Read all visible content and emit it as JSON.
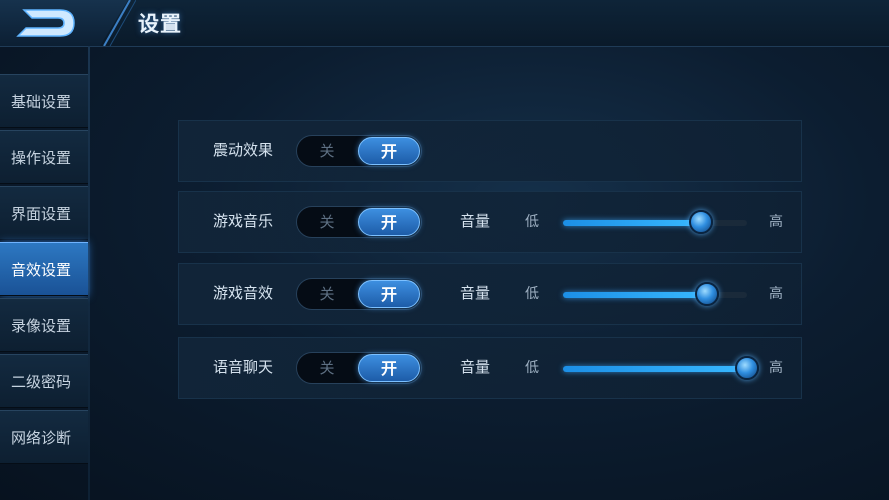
{
  "header": {
    "title": "设置"
  },
  "sidebar": {
    "items": [
      {
        "label": "基础设置",
        "active": false
      },
      {
        "label": "操作设置",
        "active": false
      },
      {
        "label": "界面设置",
        "active": false
      },
      {
        "label": "音效设置",
        "active": true
      },
      {
        "label": "录像设置",
        "active": false
      },
      {
        "label": "二级密码",
        "active": false
      },
      {
        "label": "网络诊断",
        "active": false
      }
    ]
  },
  "settings": {
    "rows": [
      {
        "label": "震动效果",
        "off_label": "关",
        "on_label": "开",
        "state": "on"
      },
      {
        "label": "游戏音乐",
        "off_label": "关",
        "on_label": "开",
        "state": "on",
        "volume_label": "音量",
        "low_label": "低",
        "high_label": "高",
        "volume": 0.75
      },
      {
        "label": "游戏音效",
        "off_label": "关",
        "on_label": "开",
        "state": "on",
        "volume_label": "音量",
        "low_label": "低",
        "high_label": "高",
        "volume": 0.78
      },
      {
        "label": "语音聊天",
        "off_label": "关",
        "on_label": "开",
        "state": "on",
        "volume_label": "音量",
        "low_label": "低",
        "high_label": "高",
        "volume": 1.0
      }
    ]
  },
  "icons": {
    "back": "back-arrow-icon"
  },
  "colors": {
    "accent": "#2d78c2",
    "slider_fill": "#38b8ff"
  }
}
